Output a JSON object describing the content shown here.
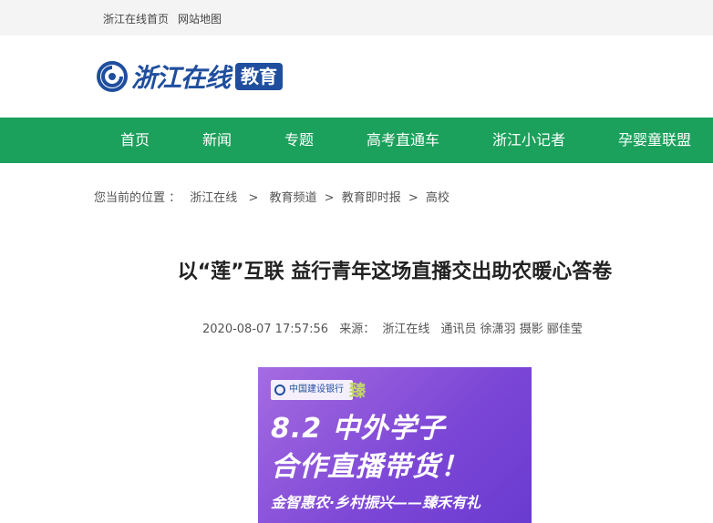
{
  "topbar": {
    "home_link": "浙江在线首页",
    "sitemap_link": "网站地图"
  },
  "logo": {
    "text": "浙江在线",
    "tag": "教育"
  },
  "nav": {
    "items": [
      {
        "label": "首页"
      },
      {
        "label": "新闻"
      },
      {
        "label": "专题"
      },
      {
        "label": "高考直通车"
      },
      {
        "label": "浙江小记者"
      },
      {
        "label": "孕婴童联盟"
      }
    ]
  },
  "breadcrumb": {
    "prefix": "您当前的位置 ：",
    "items": [
      "浙江在线",
      "教育频道",
      "教育即时报",
      "高校"
    ],
    "separator": ">"
  },
  "article": {
    "title": "以“莲”互联 益行青年这场直播交出助农暖心答卷",
    "date": "2020-08-07 17:57:56",
    "source_label": "来源：",
    "source": "浙江在线",
    "credits": "通讯员 徐潇羽 摄影 郦佳莹"
  },
  "banner": {
    "bank_name": "中国建设银行",
    "seal_text": "臻",
    "line1": "8.2 中外学子",
    "line2": "合作直播带货！",
    "line3": "金智惠农·乡村振兴——臻禾有礼"
  },
  "colors": {
    "nav_green": "#1ba15c",
    "brand_blue": "#1f4e9e",
    "banner_purple": "#7b46d6"
  }
}
